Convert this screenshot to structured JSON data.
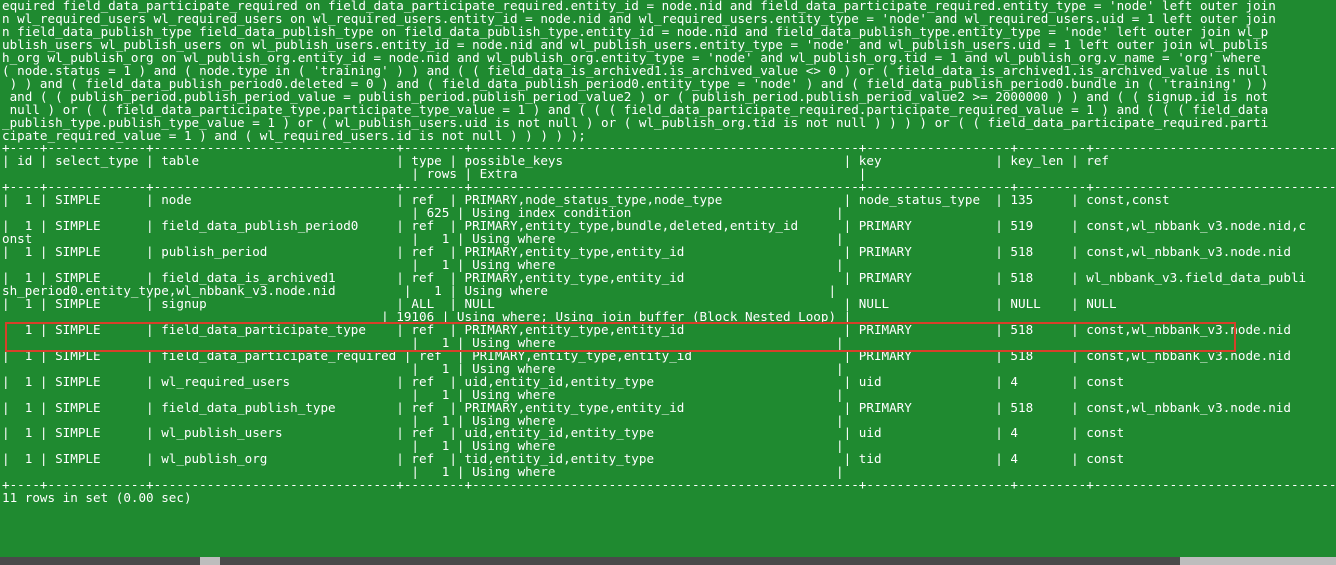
{
  "terminal": {
    "query_tail": [
      "equired field_data_participate_required on field_data_participate_required.entity_id = node.nid and field_data_participate_required.entity_type = 'node' left outer join",
      "n wl_required_users wl_required_users on wl_required_users.entity_id = node.nid and wl_required_users.entity_type = 'node' and wl_required_users.uid = 1 left outer join",
      "n field_data_publish_type field_data_publish_type on field_data_publish_type.entity_id = node.nid and field_data_publish_type.entity_type = 'node' left outer join wl_p",
      "ublish_users wl_publish_users on wl_publish_users.entity_id = node.nid and wl_publish_users.entity_type = 'node' and wl_publish_users.uid = 1 left outer join wl_publis",
      "h_org wl_publish_org on wl_publish_org.entity_id = node.nid and wl_publish_org.entity_type = 'node' and wl_publish_org.tid = 1 and wl_publish_org.v_name = 'org' where",
      "( node.status = 1 ) and ( node.type in ( 'training' ) ) and ( ( field_data_is_archived1.is_archived_value <> 0 ) or ( field_data_is_archived1.is_archived_value is null",
      " ) ) and ( field_data_publish_period0.deleted = 0 ) and ( field_data_publish_period0.entity_type = 'node' ) and ( field_data_publish_period0.bundle in ( 'training' ) )",
      " and ( ( publish_period.publish_period_value = publish_period.publish_period_value2 ) or ( publish_period.publish_period_value2 >= 2000000 ) ) and ( ( signup.id is not",
      " null ) or ( ( field_data_participate_type.participate_type_value = 1 ) and ( ( ( field_data_participate_required.participate_required_value = 1 ) and ( ( ( field_data",
      "_publish_type.publish_type_value = 1 ) or ( wl_publish_users.uid is not null ) or ( wl_publish_org.tid is not null ) ) ) ) or ( ( field_data_participate_required.parti",
      "cipate_required_value = 1 ) and ( wl_required_users.id is not null ) ) ) ) );"
    ],
    "border": "+----+-------------+--------------------------------+--------+---------------------------------------------------+-------------------+---------+---------------------------------",
    "header_lines": [
      "| id | select_type | table                          | type | possible_keys                                     | key               | key_len | ref",
      "                                                      | rows | Extra                                             |"
    ],
    "rows": [
      {
        "line1": "|  1 | SIMPLE      | node                           | ref  | PRIMARY,node_status_type,node_type                | node_status_type  | 135     | const,const",
        "line2": "                                                      | 625 | Using index condition                           |"
      },
      {
        "line1": "|  1 | SIMPLE      | field_data_publish_period0     | ref  | PRIMARY,entity_type,bundle,deleted,entity_id      | PRIMARY           | 519     | const,wl_nbbank_v3.node.nid,c",
        "line2": "onst                                                  |   1 | Using where                                     |"
      },
      {
        "line1": "|  1 | SIMPLE      | publish_period                 | ref  | PRIMARY,entity_type,entity_id                     | PRIMARY           | 518     | const,wl_nbbank_v3.node.nid",
        "line2": "                                                      |   1 | Using where                                     |"
      },
      {
        "line1": "|  1 | SIMPLE      | field_data_is_archived1        | ref  | PRIMARY,entity_type,entity_id                     | PRIMARY           | 518     | wl_nbbank_v3.field_data_publi",
        "line2": "sh_period0.entity_type,wl_nbbank_v3.node.nid         |   1 | Using where                                     |"
      },
      {
        "line1": "|  1 | SIMPLE      | signup                         | ALL  | NULL                                              | NULL              | NULL    | NULL",
        "line2": "                                                  | 19106 | Using where; Using join buffer (Block Nested Loop) |"
      },
      {
        "line1": "|  1 | SIMPLE      | field_data_participate_type    | ref  | PRIMARY,entity_type,entity_id                     | PRIMARY           | 518     | const,wl_nbbank_v3.node.nid",
        "line2": "                                                      |   1 | Using where                                     |"
      },
      {
        "line1": "|  1 | SIMPLE      | field_data_participate_required | ref  | PRIMARY,entity_type,entity_id                    | PRIMARY           | 518     | const,wl_nbbank_v3.node.nid",
        "line2": "                                                      |   1 | Using where                                     |"
      },
      {
        "line1": "|  1 | SIMPLE      | wl_required_users              | ref  | uid,entity_id,entity_type                         | uid               | 4       | const",
        "line2": "                                                      |   1 | Using where                                     |"
      },
      {
        "line1": "|  1 | SIMPLE      | field_data_publish_type        | ref  | PRIMARY,entity_type,entity_id                     | PRIMARY           | 518     | const,wl_nbbank_v3.node.nid",
        "line2": "                                                      |   1 | Using where                                     |"
      },
      {
        "line1": "|  1 | SIMPLE      | wl_publish_users               | ref  | uid,entity_id,entity_type                         | uid               | 4       | const",
        "line2": "                                                      |   1 | Using where                                     |"
      },
      {
        "line1": "|  1 | SIMPLE      | wl_publish_org                 | ref  | tid,entity_id,entity_type                         | tid               | 4       | const",
        "line2": "                                                      |   1 | Using where                                     |"
      }
    ],
    "footer": "11 rows in set (0.00 sec)",
    "colors": {
      "background": "#1f8a30",
      "text": "#ffffff",
      "highlight": "#d6402a"
    }
  }
}
